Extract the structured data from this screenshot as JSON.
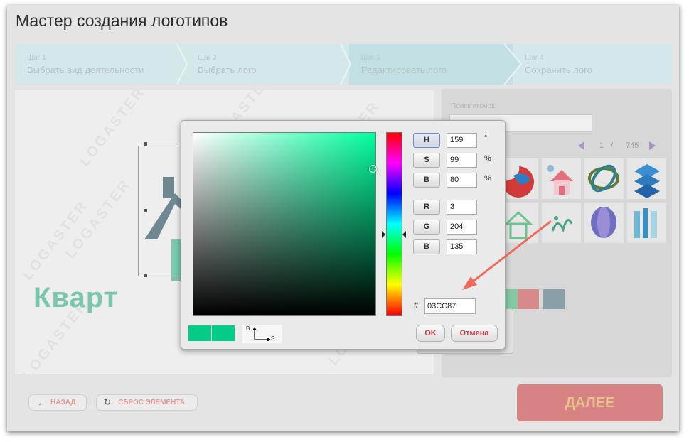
{
  "window": {
    "title": "Мастер создания логотипов"
  },
  "steps": [
    {
      "num": "Шаг 1",
      "title": "Выбрать вид деятельности"
    },
    {
      "num": "Шаг 2",
      "title": "Выбрать лого"
    },
    {
      "num": "Шаг 3",
      "title": "Редактировать лого"
    },
    {
      "num": "Шаг 4",
      "title": "Сохранить лого"
    }
  ],
  "canvas": {
    "watermark": "LOGASTER",
    "brand_text": "Кварт"
  },
  "icon_panel": {
    "search_label": "Поиск иконок:",
    "search_value": "",
    "page_current": "1",
    "page_sep": "/",
    "page_total": "745",
    "icons": [
      "swirl-ball-icon",
      "house-icon",
      "ribbon-knot-icon",
      "blue-s-icon",
      "green-house-icon",
      "floral-icon",
      "blue-sphere-icon",
      "columns-icon"
    ],
    "palette": [
      "#84c8a4",
      "#d88a8a",
      "#8aa0a8"
    ]
  },
  "color_picker": {
    "fields": [
      {
        "label": "H",
        "value": "159",
        "unit": "°"
      },
      {
        "label": "S",
        "value": "99",
        "unit": "%"
      },
      {
        "label": "B",
        "value": "80",
        "unit": "%"
      },
      {
        "label": "R",
        "value": "3",
        "unit": ""
      },
      {
        "label": "G",
        "value": "204",
        "unit": ""
      },
      {
        "label": "B",
        "value": "135",
        "unit": ""
      }
    ],
    "hash": "#",
    "hex": "03CC87",
    "axis_b": "B",
    "axis_s": "S",
    "ok_label": "OK",
    "cancel_label": "Отмена",
    "current_color": "#03cc87",
    "new_color": "#03cc87"
  },
  "buttons": {
    "back": "НАЗАД",
    "reset": "СБРОС ЭЛЕМЕНТА",
    "next": "ДАЛЕЕ"
  },
  "colors": {
    "accent": "#03cc87",
    "arrow": "#ef6a5a",
    "next_bg": "#d88383"
  }
}
